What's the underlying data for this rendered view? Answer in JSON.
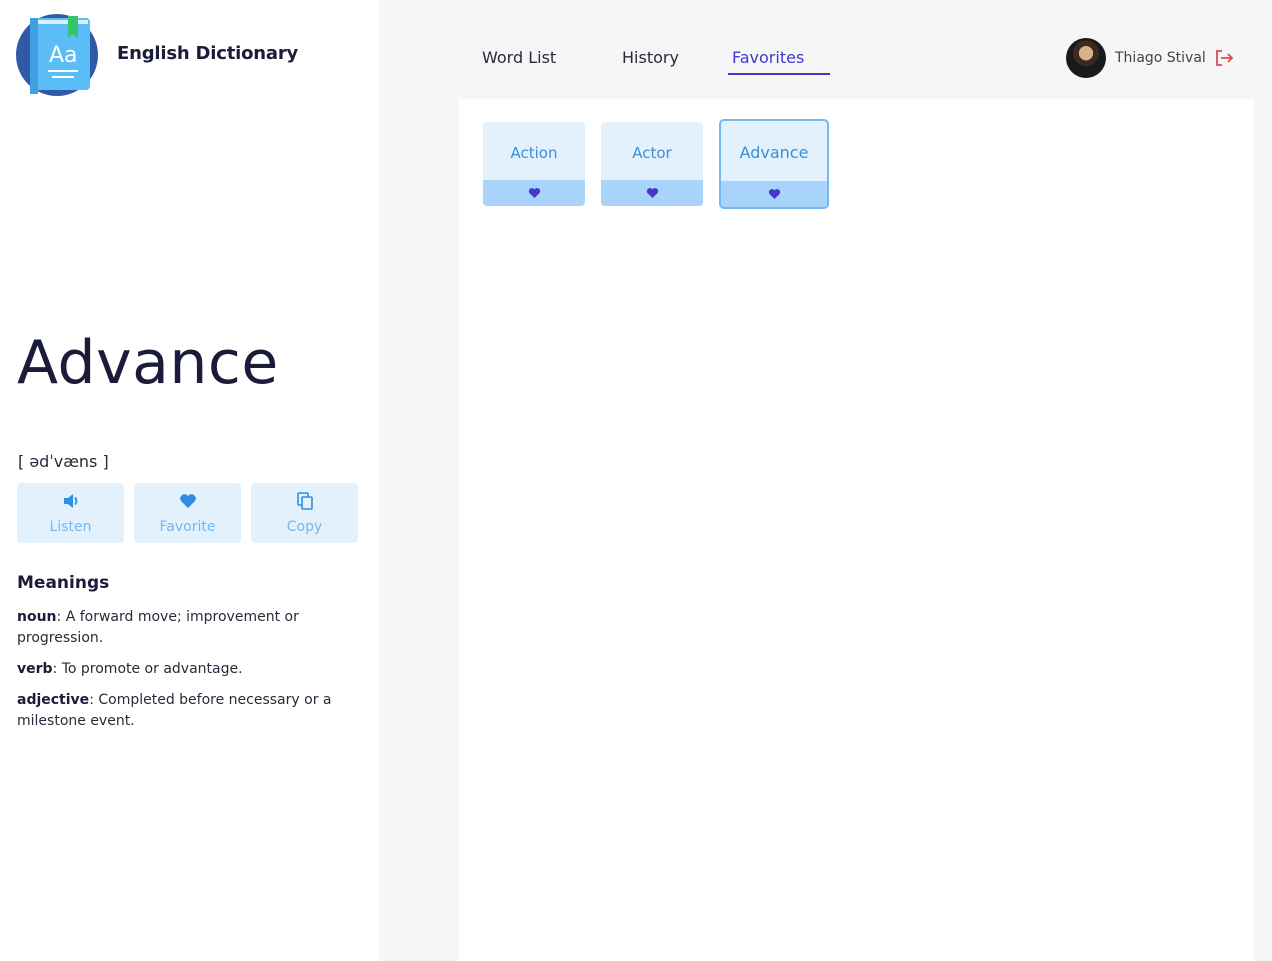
{
  "app": {
    "title": "English Dictionary",
    "logo_icon": "dictionary-book-icon"
  },
  "word": {
    "title": "Advance",
    "phonetic": "[ ədˈvæns ]"
  },
  "actions": [
    {
      "label": "Listen",
      "icon": "speaker-icon"
    },
    {
      "label": "Favorite",
      "icon": "heart-icon"
    },
    {
      "label": "Copy",
      "icon": "copy-icon"
    }
  ],
  "meanings": {
    "title": "Meanings",
    "items": [
      {
        "pos": "noun",
        "definition": ": A forward move; improvement or progression."
      },
      {
        "pos": "verb",
        "definition": ": To promote or advantage."
      },
      {
        "pos": "adjective",
        "definition": ": Completed before necessary or a milestone event."
      }
    ]
  },
  "nav": {
    "tabs": [
      {
        "label": "Word List",
        "active": false
      },
      {
        "label": "History",
        "active": false
      },
      {
        "label": "Favorites",
        "active": true
      }
    ]
  },
  "user": {
    "name": "Thiago Stival",
    "logout_icon": "logout-icon"
  },
  "favorites": [
    {
      "word": "Action",
      "selected": false
    },
    {
      "word": "Actor",
      "selected": false
    },
    {
      "word": "Advance",
      "selected": true
    }
  ],
  "colors": {
    "accent": "#4338ca",
    "light_blue": "#e3f1fd",
    "mid_blue": "#a8d4fb",
    "text_blue": "#3a8fd6",
    "logout": "#e0484f"
  }
}
